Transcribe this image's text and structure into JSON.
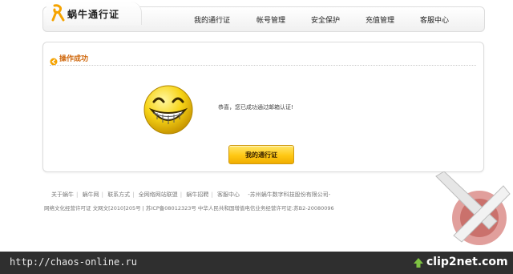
{
  "header": {
    "logo_text": "蜗牛通行证",
    "nav": [
      {
        "label": "我的通行证"
      },
      {
        "label": "帐号管理"
      },
      {
        "label": "安全保护"
      },
      {
        "label": "充值管理"
      },
      {
        "label": "客服中心"
      }
    ]
  },
  "panel": {
    "title": "操作成功",
    "message": "恭喜，您已成功通过邮箱认证!",
    "button_label": "我的通行证"
  },
  "footer": {
    "links": [
      "关于蜗牛",
      "蜗牛网",
      "联系方式",
      "全网络网站联盟",
      "蜗牛招聘",
      "客服中心"
    ],
    "company": "-苏州蜗牛数字科技股份有限公司-",
    "license": "网络文化经营许可证 文网文[2010]205号 | 苏ICP备08012323号 中华人民共和国增值电信业务经营许可证:苏B2-20080096"
  },
  "watermark": {
    "url": "http://chaos-online.ru",
    "brand": "clip2net.com"
  },
  "colors": {
    "accent_orange": "#d06a10",
    "button_gold": "#ffc814",
    "smiley_yellow": "#f7d417"
  }
}
